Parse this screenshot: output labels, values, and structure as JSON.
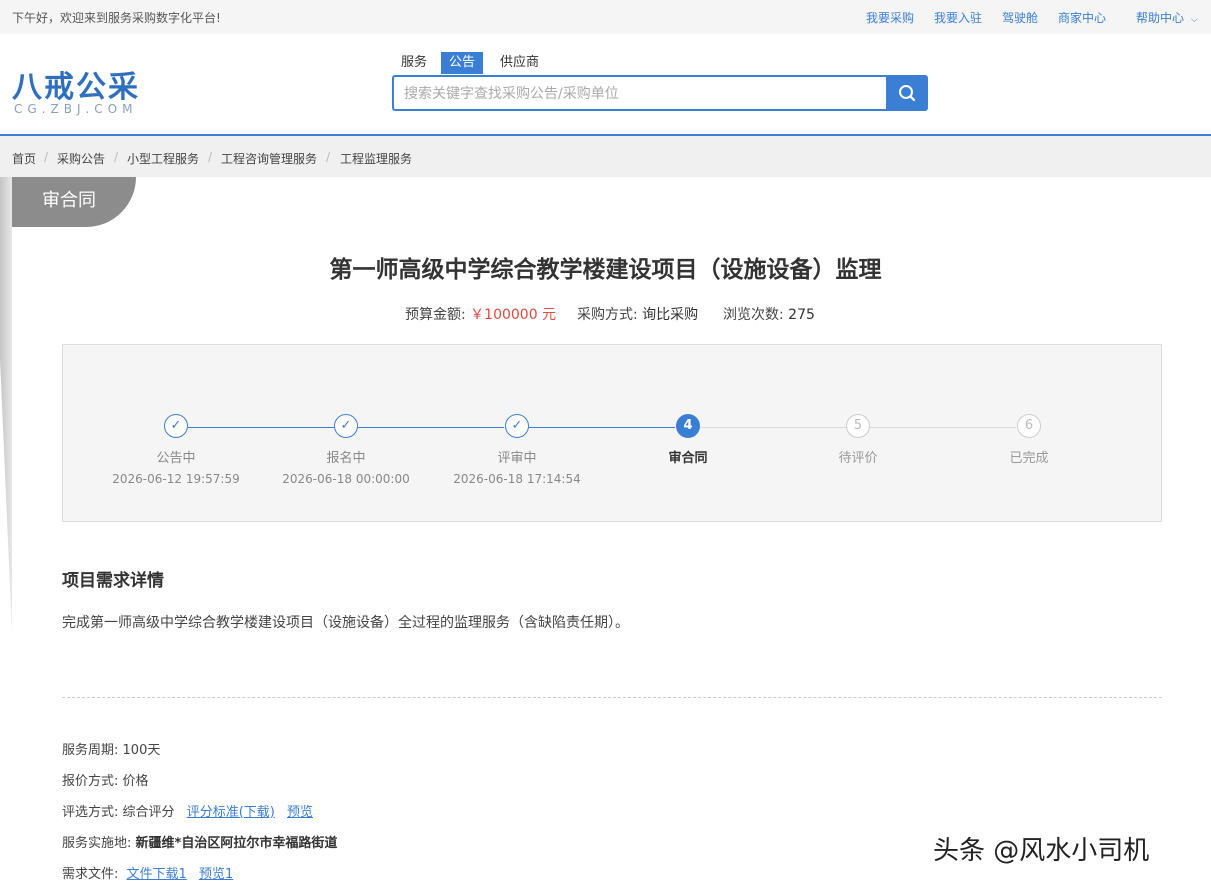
{
  "topbar": {
    "greeting": "下午好，欢迎来到服务采购数字化平台!",
    "links": [
      "我要采购",
      "我要入驻",
      "驾驶舱",
      "商家中心"
    ],
    "help": "帮助中心"
  },
  "logo": {
    "main": "八戒公采",
    "sub": "CG.ZBJ.COM"
  },
  "search": {
    "tabs": [
      "服务",
      "公告",
      "供应商"
    ],
    "active_tab": "公告",
    "placeholder": "搜索关键字查找采购公告/采购单位"
  },
  "breadcrumb": [
    "首页",
    "采购公告",
    "小型工程服务",
    "工程咨询管理服务",
    "工程监理服务"
  ],
  "status_ribbon": "审合同",
  "project": {
    "title": "第一师高级中学综合教学楼建设项目（设施设备）监理",
    "budget_label": "预算金额:",
    "budget_value": "￥100000 元",
    "method_label": "采购方式:",
    "method_value": "询比采购",
    "views_label": "浏览次数:",
    "views_value": "275"
  },
  "steps": [
    {
      "number": "✓",
      "name": "公告中",
      "time": "2026-06-12 19:57:59",
      "state": "done"
    },
    {
      "number": "✓",
      "name": "报名中",
      "time": "2026-06-18 00:00:00",
      "state": "done"
    },
    {
      "number": "✓",
      "name": "评审中",
      "time": "2026-06-18 17:14:54",
      "state": "done"
    },
    {
      "number": "4",
      "name": "审合同",
      "time": "",
      "state": "current"
    },
    {
      "number": "5",
      "name": "待评价",
      "time": "",
      "state": "todo"
    },
    {
      "number": "6",
      "name": "已完成",
      "time": "",
      "state": "todo"
    }
  ],
  "details": {
    "section_title": "项目需求详情",
    "description": "完成第一师高级中学综合教学楼建设项目（设施设备）全过程的监理服务（含缺陷责任期）。",
    "service_period_label": "服务周期:",
    "service_period_value": "100天",
    "quote_label": "报价方式:",
    "quote_value": "价格",
    "eval_label": "评选方式:",
    "eval_value": "综合评分",
    "eval_link_download": "评分标准(下载)",
    "eval_link_preview": "预览",
    "location_label": "服务实施地:",
    "location_value": "新疆维*自治区阿拉尔市幸福路街道",
    "files_label": "需求文件:",
    "files_link_download": "文件下载1",
    "files_link_preview": "预览1"
  },
  "watermark": "头条 @风水小司机",
  "colors": {
    "accent": "#3b7fd4",
    "price": "#e04b3f",
    "ribbon": "#8c8c8c"
  }
}
